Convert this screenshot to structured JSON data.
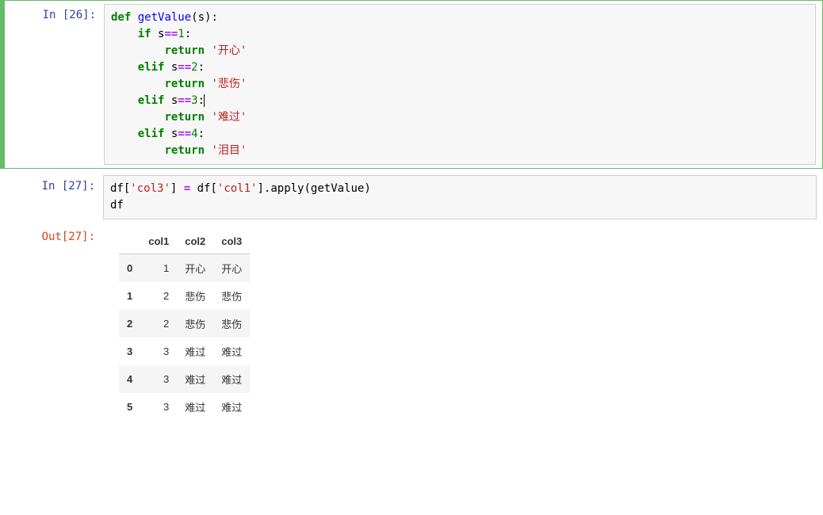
{
  "cells": [
    {
      "prompt_in": "In [26]:",
      "code_tokens": [
        [
          {
            "t": "def",
            "c": "kw"
          },
          {
            "t": " "
          },
          {
            "t": "getValue",
            "c": "fn"
          },
          {
            "t": "(s):"
          }
        ],
        [
          {
            "t": "    "
          },
          {
            "t": "if",
            "c": "kw"
          },
          {
            "t": " s"
          },
          {
            "t": "==",
            "c": "op"
          },
          {
            "t": "1",
            "c": "num"
          },
          {
            "t": ":"
          }
        ],
        [
          {
            "t": "        "
          },
          {
            "t": "return",
            "c": "kw"
          },
          {
            "t": " "
          },
          {
            "t": "'开心'",
            "c": "str"
          }
        ],
        [
          {
            "t": "    "
          },
          {
            "t": "elif",
            "c": "kw"
          },
          {
            "t": " s"
          },
          {
            "t": "==",
            "c": "op"
          },
          {
            "t": "2",
            "c": "num"
          },
          {
            "t": ":"
          }
        ],
        [
          {
            "t": "        "
          },
          {
            "t": "return",
            "c": "kw"
          },
          {
            "t": " "
          },
          {
            "t": "'悲伤'",
            "c": "str"
          }
        ],
        [
          {
            "t": "    "
          },
          {
            "t": "elif",
            "c": "kw"
          },
          {
            "t": " s"
          },
          {
            "t": "==",
            "c": "op"
          },
          {
            "t": "3",
            "c": "num"
          },
          {
            "t": ":"
          },
          {
            "t": "",
            "cursor": true
          }
        ],
        [
          {
            "t": "        "
          },
          {
            "t": "return",
            "c": "kw"
          },
          {
            "t": " "
          },
          {
            "t": "'难过'",
            "c": "str"
          }
        ],
        [
          {
            "t": "    "
          },
          {
            "t": "elif",
            "c": "kw"
          },
          {
            "t": " s"
          },
          {
            "t": "==",
            "c": "op"
          },
          {
            "t": "4",
            "c": "num"
          },
          {
            "t": ":"
          }
        ],
        [
          {
            "t": "        "
          },
          {
            "t": "return",
            "c": "kw"
          },
          {
            "t": " "
          },
          {
            "t": "'泪目'",
            "c": "str"
          }
        ]
      ]
    },
    {
      "prompt_in": "In [27]:",
      "prompt_out": "Out[27]:",
      "code_tokens": [
        [
          {
            "t": "df["
          },
          {
            "t": "'col3'",
            "c": "str"
          },
          {
            "t": "] "
          },
          {
            "t": "=",
            "c": "op"
          },
          {
            "t": " df["
          },
          {
            "t": "'col1'",
            "c": "str"
          },
          {
            "t": "]"
          },
          {
            "t": "."
          },
          {
            "t": "apply(getValue)"
          }
        ],
        [
          {
            "t": "df"
          }
        ]
      ],
      "dataframe": {
        "columns": [
          "col1",
          "col2",
          "col3"
        ],
        "index": [
          "0",
          "1",
          "2",
          "3",
          "4",
          "5"
        ],
        "rows": [
          [
            "1",
            "开心",
            "开心"
          ],
          [
            "2",
            "悲伤",
            "悲伤"
          ],
          [
            "2",
            "悲伤",
            "悲伤"
          ],
          [
            "3",
            "难过",
            "难过"
          ],
          [
            "3",
            "难过",
            "难过"
          ],
          [
            "3",
            "难过",
            "难过"
          ]
        ]
      }
    }
  ]
}
